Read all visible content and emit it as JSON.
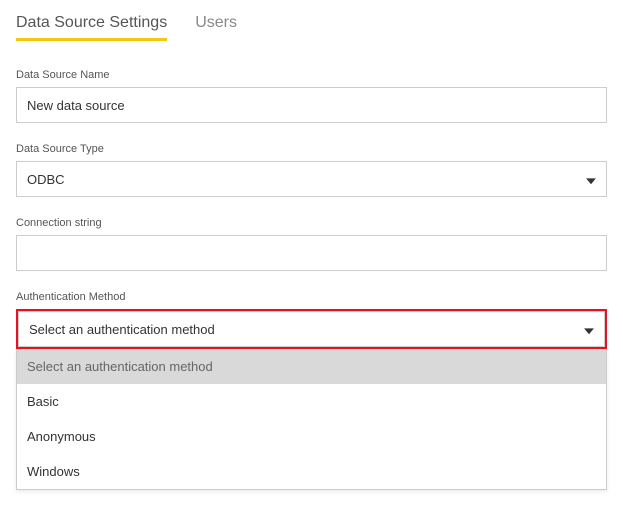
{
  "tabs": {
    "settings": "Data Source Settings",
    "users": "Users"
  },
  "fields": {
    "name_label": "Data Source Name",
    "name_value": "New data source",
    "type_label": "Data Source Type",
    "type_value": "ODBC",
    "conn_label": "Connection string",
    "conn_value": "",
    "auth_label": "Authentication Method",
    "auth_value": "Select an authentication method"
  },
  "auth_options": {
    "placeholder": "Select an authentication method",
    "opt1": "Basic",
    "opt2": "Anonymous",
    "opt3": "Windows"
  }
}
